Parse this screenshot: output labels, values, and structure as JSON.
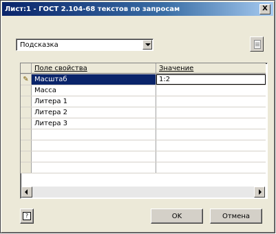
{
  "window": {
    "title": "Лист:1 - ГОСТ 2.104-68 текстов по запросам",
    "close_label": "X"
  },
  "toolbar": {
    "combo_value": "Подсказка",
    "copy_icon": "copy-icon"
  },
  "grid": {
    "headers": [
      "Поле свойства",
      "Значение"
    ],
    "rows": [
      {
        "field": "Масштаб",
        "value": "1:2",
        "editing": true
      },
      {
        "field": "Масса",
        "value": ""
      },
      {
        "field": "Литера 1",
        "value": ""
      },
      {
        "field": "Литера 2",
        "value": ""
      },
      {
        "field": "Литера 3",
        "value": ""
      },
      {
        "field": "",
        "value": ""
      },
      {
        "field": "",
        "value": ""
      },
      {
        "field": "",
        "value": ""
      },
      {
        "field": "",
        "value": ""
      }
    ],
    "edit_marker": "✎"
  },
  "buttons": {
    "help_label": "?",
    "ok_label": "OK",
    "cancel_label": "Отмена"
  },
  "colors": {
    "title_bar_start": "#0a246a",
    "title_bar_end": "#a6caf0",
    "selection": "#0a246a",
    "face": "#ece9d8"
  }
}
